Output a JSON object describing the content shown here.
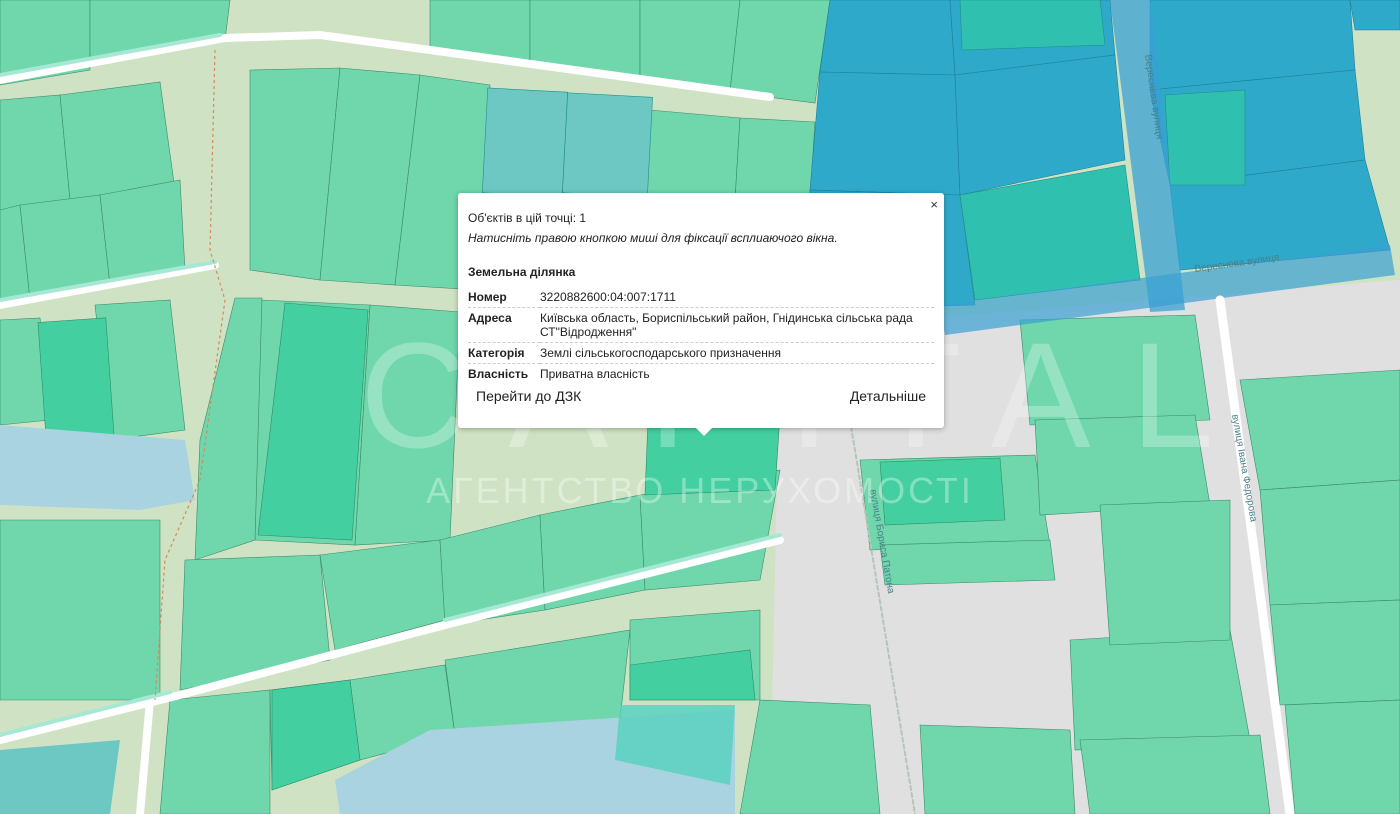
{
  "map": {
    "colors": {
      "background": "#cfe3c4",
      "parcel_green": "#6fd7ab",
      "parcel_blue": "#2fa9c9",
      "road_white": "#ffffff",
      "water": "#a9d3e0",
      "gray_area": "#e0e0e0"
    },
    "streets": [
      "Вереснева вулиця",
      "Вереснева вулиця",
      "вулиця Івана Федорова",
      "вулиця Бориса Патона"
    ]
  },
  "watermark": {
    "main": "CAPITAL",
    "sub": "АГЕНТСТВО НЕРУХОМОСТІ"
  },
  "popup": {
    "close": "×",
    "objects_count": "Об'єктів в цій точці: 1",
    "hint": "Натисніть правою кнопкою миші для фіксації всплиаючого вікна.",
    "title": "Земельна ділянка",
    "fields": [
      {
        "label": "Номер",
        "value": "3220882600:04:007:1711"
      },
      {
        "label": "Адреса",
        "value": "Київська область, Бориспільський район, Гнідинська сільська рада СТ\"Відродження\""
      },
      {
        "label": "Категорія",
        "value": "Землі сільськогосподарського призначення"
      },
      {
        "label": "Власність",
        "value": "Приватна власність"
      }
    ],
    "go_button": "Перейти до ДЗК",
    "details_button": "Детальніше"
  }
}
